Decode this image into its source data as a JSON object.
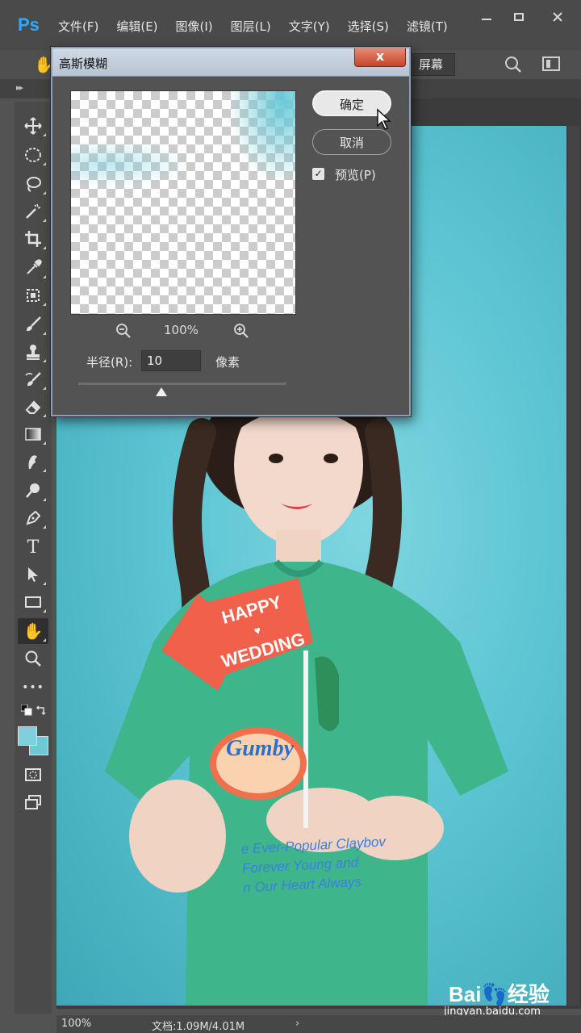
{
  "app": {
    "logo": "Ps",
    "menu": [
      "文件(F)",
      "编辑(E)",
      "图像(I)",
      "图层(L)",
      "文字(Y)",
      "选择(S)",
      "滤镜(T)"
    ],
    "window_controls": [
      "minimize-icon",
      "maximize-icon",
      "close-icon"
    ]
  },
  "options_bar": {
    "fullscreen_label": "屏幕"
  },
  "toolbar": {
    "tools": [
      "move-icon",
      "marquee-icon",
      "lasso-icon",
      "magic-wand-icon",
      "crop-icon",
      "eyedropper-icon",
      "spot-healing-icon",
      "brush-icon",
      "stamp-icon",
      "history-brush-icon",
      "eraser-icon",
      "gradient-icon",
      "smudge-icon",
      "dodge-icon",
      "pen-icon",
      "type-icon",
      "path-select-icon",
      "rectangle-icon",
      "hand-icon",
      "zoom-icon",
      "more-icon"
    ],
    "active_tool": "hand-icon",
    "type_tool_label": "T",
    "more_label": "•••",
    "foreground_color": "#7fd0dc",
    "background_color": "#6ec8d6"
  },
  "dialog": {
    "title": "高斯模糊",
    "close_label": "x",
    "ok_label": "确定",
    "cancel_label": "取消",
    "preview_label": "预览(P)",
    "preview_checked": true,
    "zoom_percent": "100%",
    "radius_label": "半径(R):",
    "radius_value": "10",
    "radius_unit": "像素",
    "slider_fraction": 0.4
  },
  "photo": {
    "sign_line1": "HAPPY",
    "sign_line2": "WEDDING",
    "shirt_brand": "Gumby",
    "shirt_text_1": "e Ever-Popular Claybov",
    "shirt_text_2": "Forever Young and",
    "shirt_text_3": "n Our Heart Always",
    "watermark_logo": "Bai👣经验",
    "watermark_url": "jingyan.baidu.com"
  },
  "status": {
    "zoom": "100%",
    "doc": "文档:1.09M/4.01M",
    "arrow": "›"
  }
}
